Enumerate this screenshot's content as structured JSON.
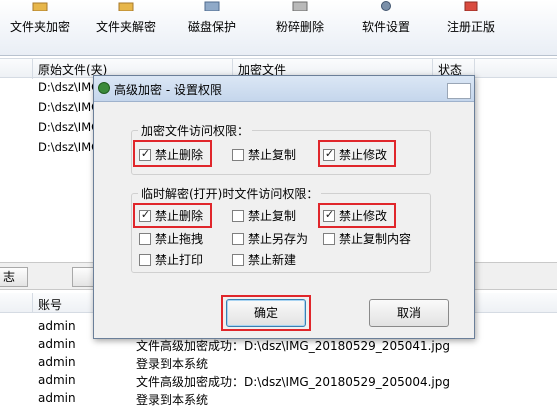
{
  "toolbar": {
    "buttons": [
      {
        "label": "文件夹加密",
        "icon": "folder-lock-icon"
      },
      {
        "label": "文件夹解密",
        "icon": "folder-unlock-icon"
      },
      {
        "label": "磁盘保护",
        "icon": "disk-shield-icon"
      },
      {
        "label": "粉碎删除",
        "icon": "shredder-icon"
      },
      {
        "label": "软件设置",
        "icon": "gear-icon"
      },
      {
        "label": "注册正版",
        "icon": "register-icon"
      }
    ]
  },
  "file_table": {
    "headers": [
      "原始文件(夹)",
      "加密文件",
      "状态"
    ],
    "rows": [
      "D:\\dsz\\IMG",
      "D:\\dsz\\IMG",
      "D:\\dsz\\IMG",
      "D:\\dsz\\IMG"
    ]
  },
  "mid_tabs": [
    "志"
  ],
  "log_table": {
    "headers": [
      "账号"
    ],
    "rows": [
      {
        "user": "admin",
        "message": ""
      },
      {
        "user": "admin",
        "message": "文件高级加密成功：D:\\dsz\\IMG_20180529_205041.jpg"
      },
      {
        "user": "admin",
        "message": "登录到本系统"
      },
      {
        "user": "admin",
        "message": "文件高级加密成功：D:\\dsz\\IMG_20180529_205004.jpg"
      },
      {
        "user": "admin",
        "message": "登录到本系统"
      }
    ]
  },
  "dialog": {
    "title": "高级加密 - 设置权限",
    "group1": {
      "legend": "加密文件访问权限：",
      "options": [
        {
          "label": "禁止删除",
          "checked": true
        },
        {
          "label": "禁止复制",
          "checked": false
        },
        {
          "label": "禁止修改",
          "checked": true
        }
      ]
    },
    "group2": {
      "legend": "临时解密(打开)时文件访问权限：",
      "options": [
        {
          "label": "禁止删除",
          "checked": true
        },
        {
          "label": "禁止复制",
          "checked": false
        },
        {
          "label": "禁止修改",
          "checked": true
        },
        {
          "label": "禁止拖拽",
          "checked": false
        },
        {
          "label": "禁止另存为",
          "checked": false
        },
        {
          "label": "禁止复制内容",
          "checked": false
        },
        {
          "label": "禁止打印",
          "checked": false
        },
        {
          "label": "禁止新建",
          "checked": false
        }
      ]
    },
    "ok_label": "确定",
    "cancel_label": "取消",
    "check_mark": "✓"
  },
  "colors": {
    "highlight": "#e0262b",
    "title_bar": "#c5d6ec"
  }
}
